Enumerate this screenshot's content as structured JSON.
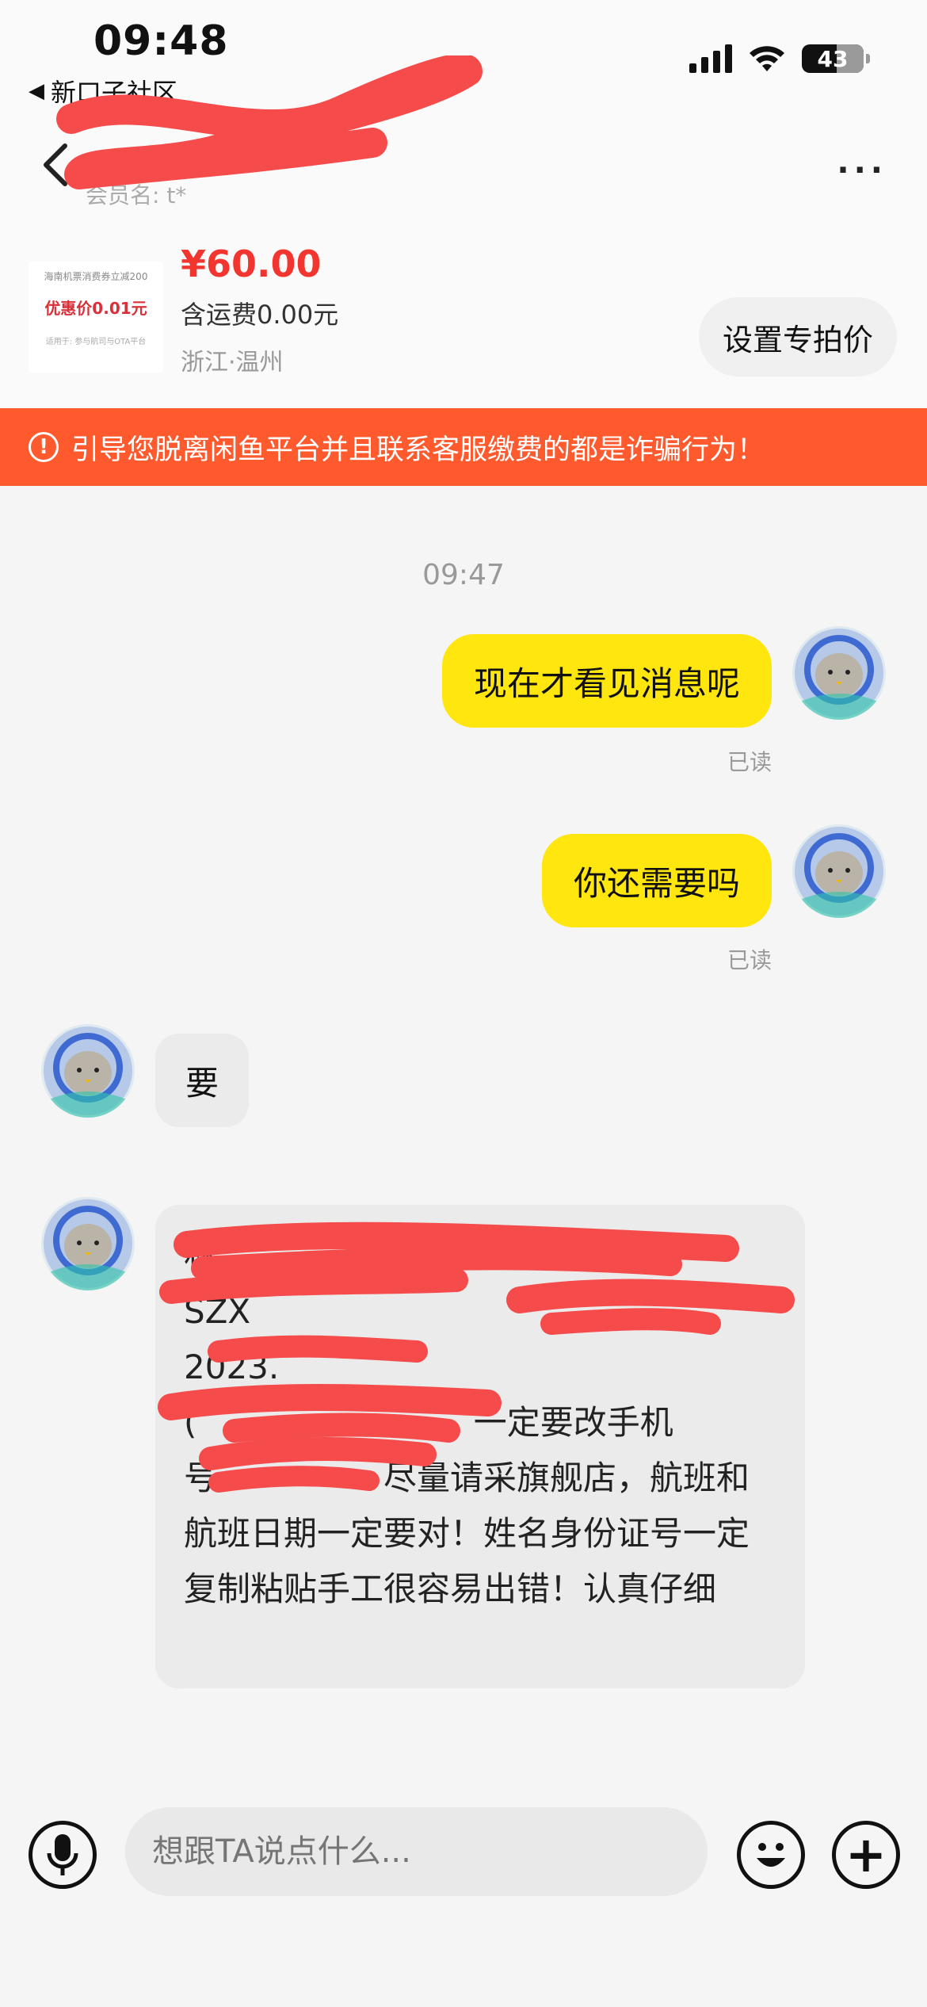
{
  "status_bar": {
    "time": "09:48",
    "back_app": "新口子社区",
    "battery": "43"
  },
  "nav": {
    "title": "",
    "member_label": "会员名: t*",
    "more": "···"
  },
  "product": {
    "thumb_line": "海南机票消费券立减200",
    "thumb_price": "优惠价0.01元",
    "thumb_small": "适用于: 参与航司与OTA平台",
    "price": "¥60.00",
    "shipping": "含运费0.00元",
    "location": "浙江·温州",
    "special_price_button": "设置专拍价"
  },
  "warning": {
    "text": "引导您脱离闲鱼平台并且联系客服缴费的都是诈骗行为！"
  },
  "chat": {
    "timestamp": "09:47",
    "messages": [
      {
        "from": "me",
        "text": "现在才看见消息呢",
        "status": "已读"
      },
      {
        "from": "me",
        "text": "你还需要吗",
        "status": "已读"
      },
      {
        "from": "them",
        "text": "要"
      },
      {
        "from": "them",
        "text": "林            深圳SZX          2023.        (         一定要改手机号     尽量请采旗舰店，航班和航班日期一定要对！姓名身份证号一定复制粘贴手工很容易出错！认真仔细"
      }
    ]
  },
  "composer": {
    "placeholder": "想跟TA说点什么..."
  },
  "colors": {
    "accent_yellow": "#ffe60f",
    "warning_orange": "#fe5a2e",
    "price_red": "#f2352f"
  }
}
